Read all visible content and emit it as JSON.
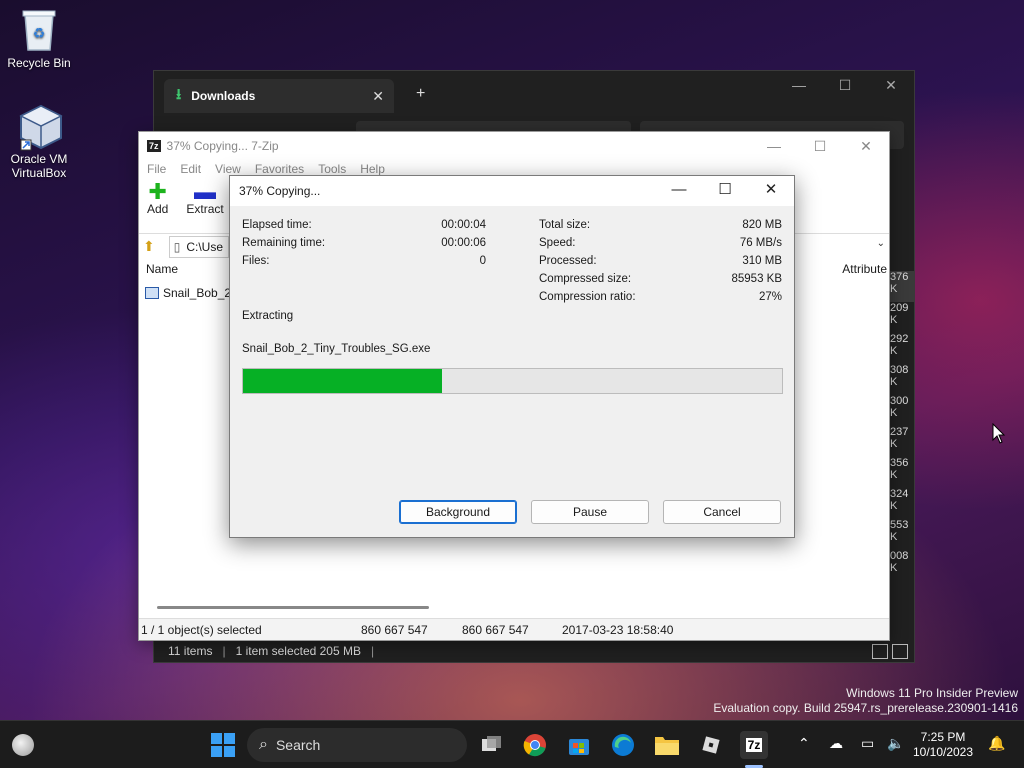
{
  "desktop": {
    "icons": [
      {
        "label": "Recycle Bin"
      },
      {
        "label_line1": "Oracle VM",
        "label_line2": "VirtualBox"
      }
    ],
    "watermark_line1": "Windows 11 Pro Insider Preview",
    "watermark_line2": "Evaluation copy. Build 25947.rs_prerelease.230901-1416"
  },
  "explorer": {
    "tab_title": "Downloads",
    "sizes_col": [
      "376 K",
      "209 K",
      "292 K",
      "308 K",
      "300 K",
      "237 K",
      "356 K",
      "324 K",
      "553 K",
      "008 K"
    ],
    "status_items": "11 items",
    "status_selected": "1 item selected  205 MB"
  },
  "zip": {
    "title": "37% Copying... 7-Zip",
    "menu": [
      "File",
      "Edit",
      "View",
      "Favorites",
      "Tools",
      "Help"
    ],
    "toolbar": {
      "add": "Add",
      "extract": "Extract"
    },
    "path": "C:\\Use",
    "col_name": "Name",
    "col_attr": "Attribute",
    "row_name": "Snail_Bob_2_",
    "status": {
      "selected": "1 / 1 object(s) selected",
      "size": "860 667 547",
      "packed": "860 667 547",
      "modified": "2017-03-23 18:58:40"
    }
  },
  "dialog": {
    "title": "37% Copying...",
    "elapsed_label": "Elapsed time:",
    "elapsed_value": "00:00:04",
    "remaining_label": "Remaining time:",
    "remaining_value": "00:00:06",
    "files_label": "Files:",
    "files_value": "0",
    "total_label": "Total size:",
    "total_value": "820 MB",
    "speed_label": "Speed:",
    "speed_value": "76 MB/s",
    "processed_label": "Processed:",
    "processed_value": "310 MB",
    "compressed_label": "Compressed size:",
    "compressed_value": "85953 KB",
    "ratio_label": "Compression ratio:",
    "ratio_value": "27%",
    "action": "Extracting",
    "filename": "Snail_Bob_2_Tiny_Troubles_SG.exe",
    "progress_percent": 37,
    "buttons": {
      "background": "Background",
      "pause": "Pause",
      "cancel": "Cancel"
    }
  },
  "taskbar": {
    "search_label": "Search",
    "time": "7:25 PM",
    "date": "10/10/2023",
    "zip_icon": "7z"
  },
  "colors": {
    "progress_fill": "#06b025",
    "accent": "#1a6fd1"
  }
}
